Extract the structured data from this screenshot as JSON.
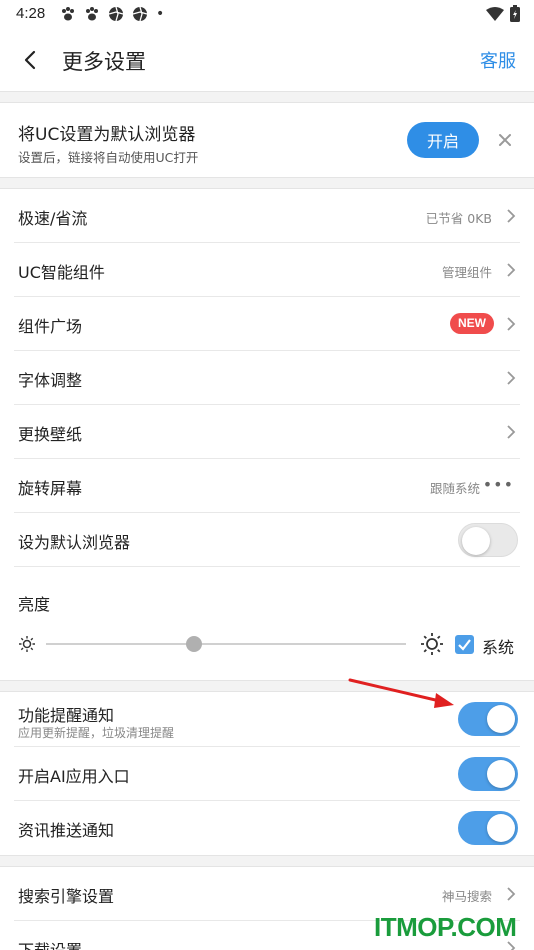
{
  "status": {
    "time": "4:28",
    "dot": "•"
  },
  "header": {
    "title": "更多设置",
    "service_label": "客服"
  },
  "banner": {
    "title": "将UC设置为默认浏览器",
    "subtitle": "设置后，链接将自动使用UC打开",
    "button_label": "开启"
  },
  "settings": {
    "speed_label": "极速/省流",
    "speed_value": "已节省 0KB",
    "widget_label": "UC智能组件",
    "widget_value": "管理组件",
    "plaza_label": "组件广场",
    "plaza_badge": "NEW",
    "font_label": "字体调整",
    "wallpaper_label": "更换壁纸",
    "rotate_label": "旋转屏幕",
    "rotate_value": "跟随系统",
    "rotate_more": "•••",
    "default_label": "设为默认浏览器",
    "default_on": false,
    "brightness_label": "亮度",
    "brightness_level": 0.41,
    "system_label": "系统",
    "system_checked": true
  },
  "notifications": {
    "feature_label": "功能提醒通知",
    "feature_sub": "应用更新提醒，垃圾清理提醒",
    "feature_on": true,
    "ai_label": "开启AI应用入口",
    "ai_on": true,
    "news_label": "资讯推送通知",
    "news_on": true
  },
  "more": {
    "search_label": "搜索引擎设置",
    "search_value": "神马搜索",
    "download_label": "下载设置"
  },
  "watermark": "ITMOP.COM",
  "colors": {
    "accent": "#2f8ee6",
    "toggle_on": "#4d9ee8",
    "badge": "#f04c4c",
    "arrow": "#e02020",
    "watermark": "#1a9c3c"
  }
}
